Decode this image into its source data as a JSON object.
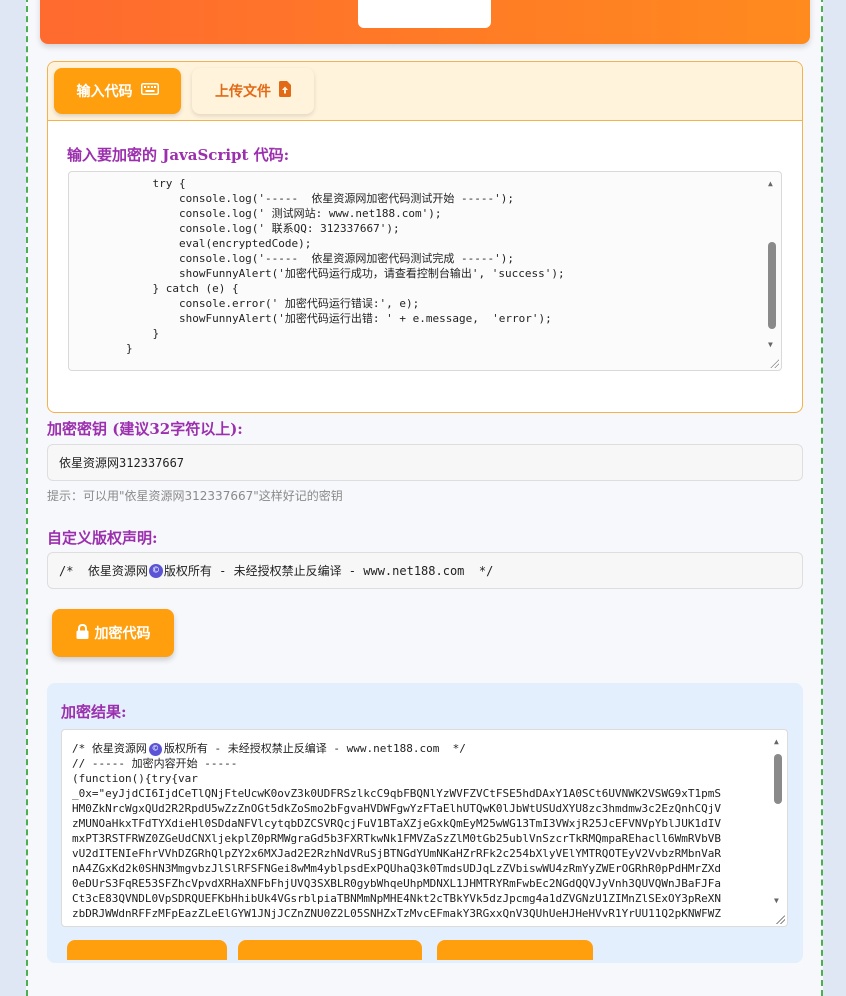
{
  "tabs": {
    "code_label": "输入代码",
    "upload_label": "上传文件"
  },
  "code_section": {
    "label": "输入要加密的 JavaScript 代码:",
    "lines": [
      "            try {",
      "                console.log('-----  依星资源网加密代码测试开始 -----');",
      "                console.log(' 测试网站: www.net188.com');",
      "                console.log(' 联系QQ: 312337667');",
      "                eval(encryptedCode);",
      "                console.log('-----  依星资源网加密代码测试完成 -----');",
      "                showFunnyAlert('加密代码运行成功，请查看控制台输出', 'success');",
      "            } catch (e) {",
      "                console.error(' 加密代码运行错误:', e);",
      "                showFunnyAlert('加密代码运行出错: ' + e.message,  'error');",
      "            }",
      "        }"
    ]
  },
  "key_section": {
    "label": "加密密钥 (建议32字符以上):",
    "value": "依星资源网312337667",
    "hint": "提示：可以用\"依星资源网312337667\"这样好记的密钥"
  },
  "copyright_section": {
    "label": "自定义版权声明:",
    "value_prefix": "/*  依星资源网",
    "copyright_symbol": "©",
    "value_suffix": "版权所有 - 未经授权禁止反编译 - www.net188.com  */"
  },
  "encrypt_button": {
    "label": "加密代码"
  },
  "result_section": {
    "label": "加密结果:",
    "first_prefix": "/* 依星资源网",
    "copyright_symbol": "©",
    "first_suffix": "版权所有 - 未经授权禁止反编译 - www.net188.com  */",
    "lines": [
      "// ----- 加密内容开始 -----",
      "(function(){try{var",
      "_0x=\"eyJjdCI6IjdCeTlQNjFteUcwK0ovZ3k0UDFRSzlkcC9qbFBQNlYzWVFZVCtFSE5hdDAxY1A0SCt6UVNWK2VSWG9xT1pmS",
      "HM0ZkNrcWgxQUd2R2RpdU5wZzZnOGt5dkZoSmo2bFgvaHVDWFgwYzFTaElhUTQwK0lJbWtUSUdXYU8zc3hmdmw3c2EzQnhCQjV",
      "zMUNOaHkxTFdTYXdieHl0SDdaNFVlcytqbDZCSVRQcjFuV1BTaXZjeGxkQmEyM25wWG13TmI3VWxjR25JcEFVNVpYblJUK1dIV",
      "mxPT3RSTFRWZ0ZGeUdCNXljekplZ0pRMWgraGd5b3FXRTkwNk1FMVZaSzZlM0tGb25ublVnSzcrTkRMQmpaREhacll6WmRVbVB",
      "vU2dITENIeFhrVVhDZGRhQlpZY2x6MXJad2E2RzhNdVRuSjBTNGdYUmNKaHZrRFk2c254bXlyVElYMTRQOTEyV2VvbzRMbnVaR",
      "nA4ZGxKd2k0SHN3MmgvbzJlSlRFSFNGei8wMm4yblpsdExPQUhaQ3k0TmdsUDJqLzZVbiswWU4zRmYyZWErOGRhR0pPdHMrZXd",
      "0eDUrS3FqRE53SFZhcVpvdXRHaXNFbFhjUVQ3SXBLR0gybWhqeUhpMDNXL1JHMTRYRmFwbEc2NGdQQVJyVnh3QUVQWnJBaFJFa",
      "Ct3cE83QVNDL0VpSDRQUEFKbHhibUk4VGsrblpiaTBNMmNpMHE4Nkt2cTBkYVk5dzJpcmg4a1dZVGNzU1ZIMnZlSExOY3pReXN",
      "zbDRJWWdnRFFzMFpEazZLeElGYW1JNjJCZnZNU0Z2L05SNHZxTzMvcEFmakY3RGxxQnV3QUhUeHJHeHVvR1YrUU11Q2pKNWFWZ"
    ]
  },
  "colors": {
    "banner": "#ff6a2f",
    "accent": "#ff9f0e",
    "purple_label": "#9b2fae",
    "upload_text": "#e26a16",
    "result_bg": "#e3effd",
    "frame_dash": "#4caf50"
  },
  "icons": {
    "code_tab": "keyboard-icon",
    "upload_tab": "file-upload-icon",
    "encrypt": "lock-icon"
  }
}
